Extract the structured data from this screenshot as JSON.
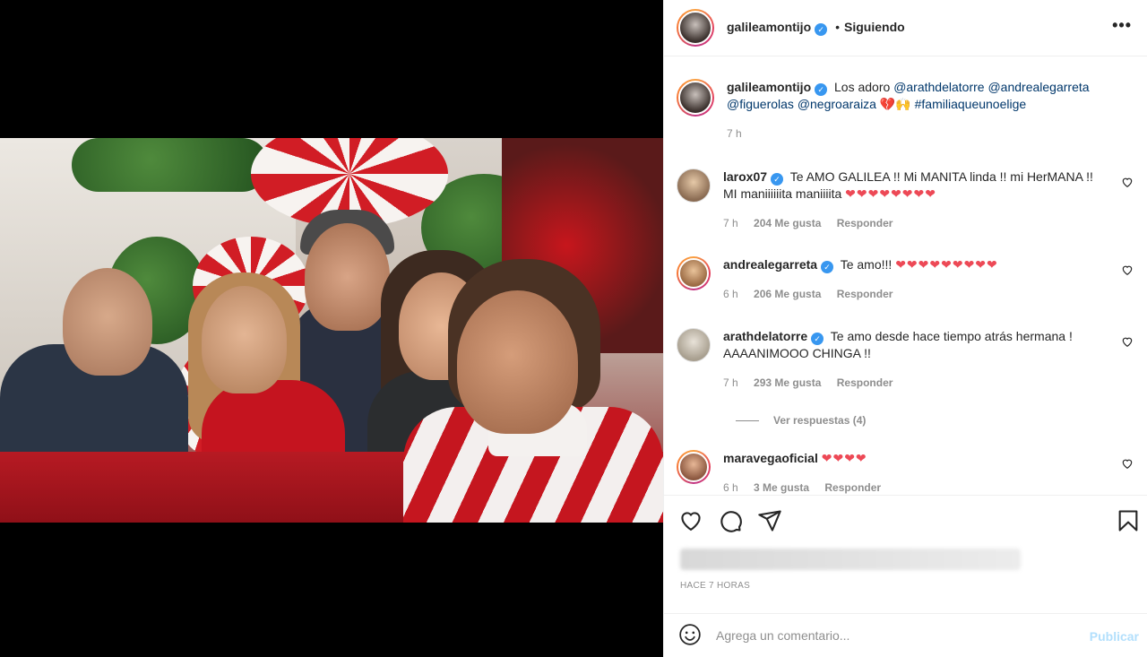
{
  "header": {
    "username": "galileamontijo",
    "separator": "•",
    "follow_label": "Siguiendo",
    "more_label": "•••"
  },
  "caption": {
    "username": "galileamontijo",
    "text_prefix": "Los adoro",
    "mentions": [
      "@arathdelatorre",
      "@andrealegarreta",
      "@figuerolas",
      "@negroaraiza"
    ],
    "emoji": "💔🙌",
    "hashtag": "#familiaqueunoelige",
    "time": "7 h"
  },
  "comments": [
    {
      "username": "larox07",
      "text": "Te AMO GALILEA !! Mi MANITA linda !! mi HerMANA !! MI maniiiiiita maniiiita",
      "hearts": "❤❤❤❤❤❤❤❤",
      "time": "7 h",
      "likes": "204 Me gusta",
      "reply": "Responder"
    },
    {
      "username": "andrealegarreta",
      "text": "Te amo!!!",
      "hearts": "❤❤❤❤❤❤❤❤❤",
      "time": "6 h",
      "likes": "206 Me gusta",
      "reply": "Responder"
    },
    {
      "username": "arathdelatorre",
      "text": "Te amo desde hace tiempo atrás hermana ! AAAANIMOOO CHINGA !!",
      "hearts": "",
      "time": "7 h",
      "likes": "293 Me gusta",
      "reply": "Responder"
    },
    {
      "username": "maravegaoficial",
      "text": "",
      "hearts": "❤❤❤❤",
      "time": "6 h",
      "likes": "3 Me gusta",
      "reply": "Responder"
    }
  ],
  "view_replies": "Ver respuestas (4)",
  "post_time": "HACE 7 HORAS",
  "add_comment": {
    "placeholder": "Agrega un comentario...",
    "publish_label": "Publicar"
  },
  "icons": {
    "like": "heart-icon",
    "comment": "comment-icon",
    "share": "paper-plane-icon",
    "save": "bookmark-icon",
    "emoji": "emoji-icon",
    "verified": "verified-badge-icon",
    "more": "more-options-icon"
  },
  "colors": {
    "link": "#00376b",
    "meta": "#8e8e8e",
    "heart": "#ed4956",
    "verified": "#3897f0",
    "publish_disabled": "#b2dffc"
  }
}
